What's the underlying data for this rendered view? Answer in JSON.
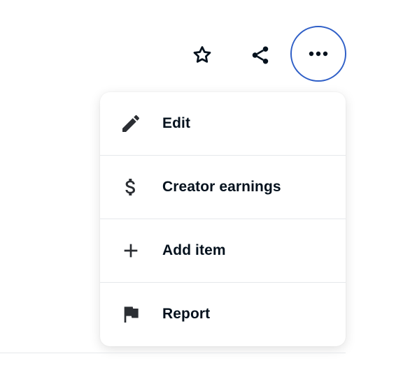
{
  "toolbar": {
    "favorite_icon": "star-outline-icon",
    "share_icon": "share-icon",
    "more_icon": "more-horizontal-icon",
    "accent_color": "#2f5fc7"
  },
  "menu": {
    "items": [
      {
        "label": "Edit",
        "icon": "pencil-icon"
      },
      {
        "label": "Creator earnings",
        "icon": "dollar-icon"
      },
      {
        "label": "Add item",
        "icon": "plus-icon"
      },
      {
        "label": "Report",
        "icon": "flag-icon"
      }
    ]
  }
}
